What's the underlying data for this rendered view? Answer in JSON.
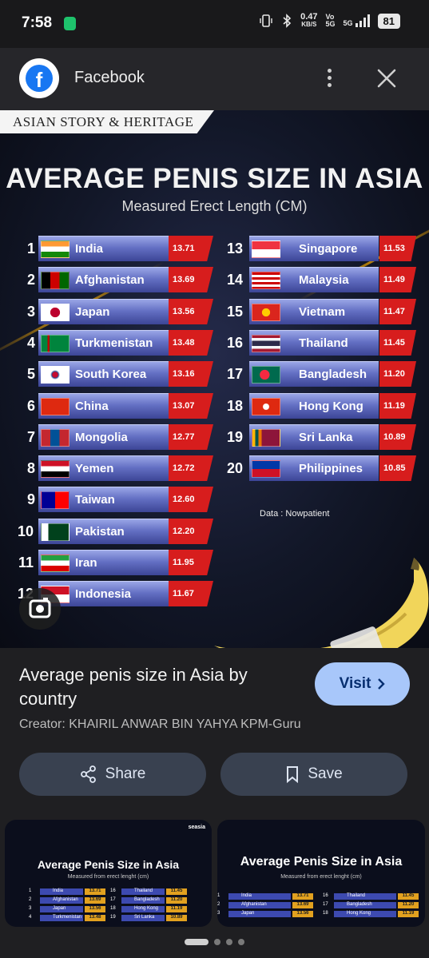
{
  "status_bar": {
    "time": "7:58",
    "speed_value": "0.47",
    "speed_unit": "KB/S",
    "network": "5G",
    "battery": "81"
  },
  "app_bar": {
    "app_icon": "facebook-icon",
    "title": "Facebook"
  },
  "infographic": {
    "brand": "ASIAN STORY & HERITAGE",
    "title": "AVERAGE PENIS SIZE IN ASIA",
    "subtitle": "Measured Erect Length (CM)",
    "source": "Data : Nowpatient"
  },
  "chart_data": {
    "type": "bar",
    "title": "AVERAGE PENIS SIZE IN ASIA",
    "subtitle": "Measured Erect Length (CM)",
    "ylabel": "",
    "unit": "CM",
    "categories": [
      "India",
      "Afghanistan",
      "Japan",
      "Turkmenistan",
      "South Korea",
      "China",
      "Mongolia",
      "Yemen",
      "Taiwan",
      "Pakistan",
      "Iran",
      "Indonesia",
      "Singapore",
      "Malaysia",
      "Vietnam",
      "Thailand",
      "Bangladesh",
      "Hong Kong",
      "Sri Lanka",
      "Philippines"
    ],
    "ranks": [
      "1",
      "2",
      "3",
      "4",
      "5",
      "6",
      "7",
      "8",
      "9",
      "10",
      "11",
      "12",
      "13",
      "14",
      "15",
      "16",
      "17",
      "18",
      "19",
      "20"
    ],
    "values": [
      13.71,
      13.69,
      13.56,
      13.48,
      13.16,
      13.07,
      12.77,
      12.72,
      12.6,
      12.2,
      11.95,
      11.67,
      11.53,
      11.49,
      11.47,
      11.45,
      11.2,
      11.19,
      10.89,
      10.85
    ],
    "value_labels": [
      "13.71",
      "13.69",
      "13.56",
      "13.48",
      "13.16",
      "13.07",
      "12.77",
      "12.72",
      "12.60",
      "12.20",
      "11.95",
      "11.67",
      "11.53",
      "11.49",
      "11.47",
      "11.45",
      "11.20",
      "11.19",
      "10.89",
      "10.85"
    ],
    "bar_color": "#6470c4",
    "value_tag_color": "#d71d1d"
  },
  "result": {
    "title": "Average penis size in Asia by country",
    "visit_label": "Visit",
    "creator": "Creator: KHAIRIL ANWAR BIN YAHYA KPM-Guru"
  },
  "actions": {
    "share_label": "Share",
    "save_label": "Save"
  },
  "thumbnails": [
    {
      "logo": "seasia",
      "title": "Average Penis Size in Asia",
      "subtitle": "Measured from erect lenght (cm)",
      "left_rows": [
        [
          "1",
          "India",
          "13.71"
        ],
        [
          "2",
          "Afghanistan",
          "13.69"
        ],
        [
          "3",
          "Japan",
          "13.56"
        ],
        [
          "4",
          "Turkmenistan",
          "13.48"
        ]
      ],
      "right_rows": [
        [
          "16",
          "Thailand",
          "11.45"
        ],
        [
          "17",
          "Bangladesh",
          "11.20"
        ],
        [
          "18",
          "Hong Kong",
          "11.19"
        ],
        [
          "19",
          "Sri Lanka",
          "10.89"
        ]
      ]
    },
    {
      "title": "Average Penis Size in Asia",
      "subtitle": "Measured from erect lenght (cm)",
      "left_rows": [
        [
          "1",
          "India",
          "13.71"
        ],
        [
          "2",
          "Afghanistan",
          "13.69"
        ],
        [
          "3",
          "Japan",
          "13.56"
        ]
      ],
      "right_rows": [
        [
          "16",
          "Thailand",
          "11.45"
        ],
        [
          "17",
          "Bangladesh",
          "11.20"
        ],
        [
          "18",
          "Hong Kong",
          "11.19"
        ]
      ]
    }
  ],
  "pager": {
    "count": 4,
    "active": 0
  }
}
